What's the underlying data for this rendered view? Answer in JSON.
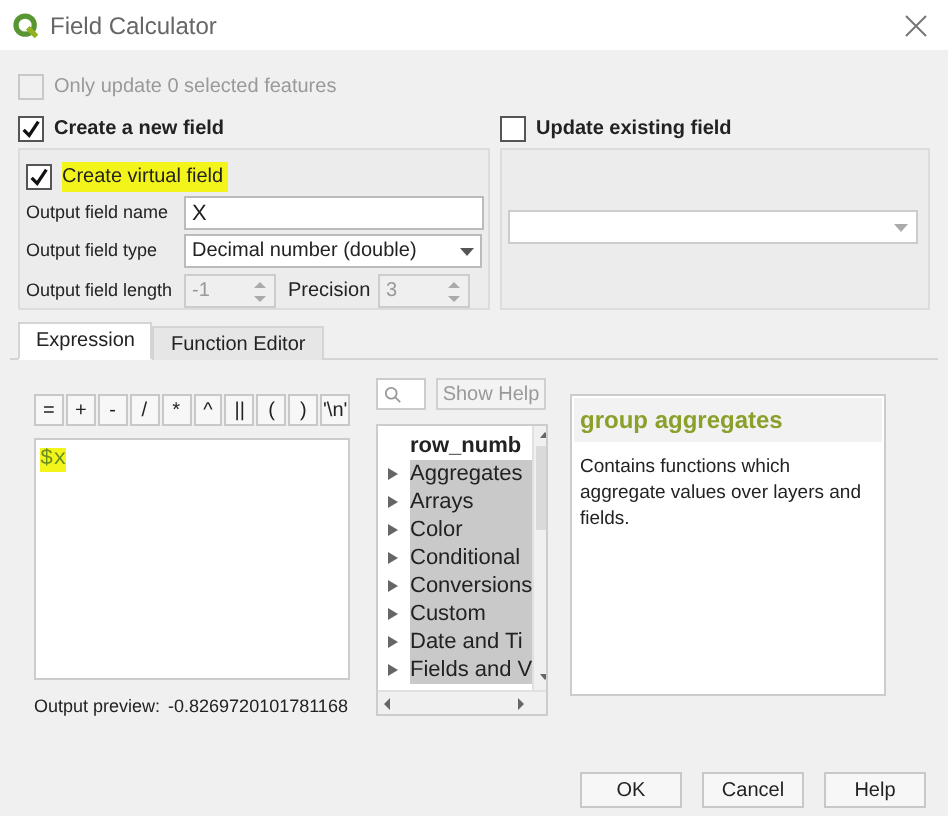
{
  "window": {
    "title": "Field Calculator"
  },
  "only_selected": {
    "label": "Only update 0 selected features",
    "checked": false,
    "disabled": true
  },
  "new_field": {
    "label": "Create a new field",
    "checked": true,
    "virtual": {
      "label": "Create virtual field",
      "checked": true,
      "highlighted": true
    },
    "name": {
      "label": "Output field name",
      "value": "X"
    },
    "type": {
      "label": "Output field type",
      "value": "Decimal number (double)"
    },
    "length": {
      "label": "Output field length",
      "value": "-1",
      "disabled": true
    },
    "precision": {
      "label": "Precision",
      "value": "3",
      "disabled": true
    }
  },
  "update_field": {
    "label": "Update existing field",
    "checked": false
  },
  "tabs": [
    {
      "label": "Expression",
      "selected": true
    },
    {
      "label": "Function Editor",
      "selected": false
    }
  ],
  "operators": [
    "=",
    "+",
    "-",
    "/",
    "*",
    "^",
    "||",
    "(",
    ")",
    "'\\n'"
  ],
  "expression": {
    "value": "$x",
    "highlighted": true
  },
  "output_preview": {
    "label": "Output preview:",
    "value": "-0.8269720101781168"
  },
  "function_list": {
    "show_help": "Show Help",
    "items": [
      {
        "label": "row_numb",
        "kind": "function"
      },
      {
        "label": "Aggregates",
        "kind": "group"
      },
      {
        "label": "Arrays",
        "kind": "group"
      },
      {
        "label": "Color",
        "kind": "group"
      },
      {
        "label": "Conditional",
        "kind": "group"
      },
      {
        "label": "Conversions",
        "kind": "group"
      },
      {
        "label": "Custom",
        "kind": "group"
      },
      {
        "label": "Date and Ti",
        "kind": "group"
      },
      {
        "label": "Fields and V",
        "kind": "group"
      }
    ]
  },
  "help": {
    "title": "group aggregates",
    "text": "Contains functions which aggregate values over layers and fields."
  },
  "buttons": [
    "OK",
    "Cancel",
    "Help"
  ]
}
